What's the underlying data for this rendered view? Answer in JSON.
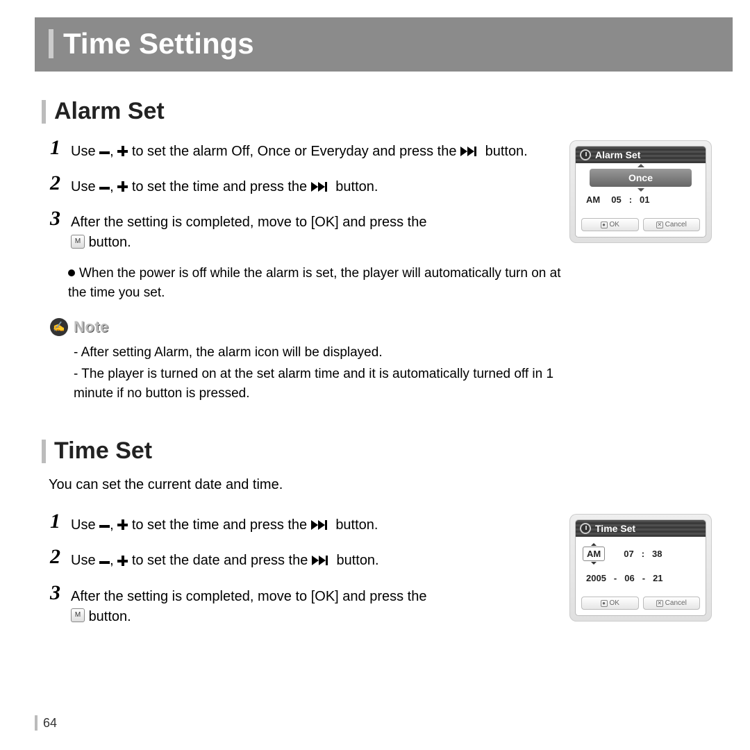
{
  "page": {
    "title": "Time Settings",
    "number": "64"
  },
  "alarm": {
    "heading": "Alarm Set",
    "step1_a": "Use ",
    "step1_b": " to set the alarm Off, Once or Everyday and press the ",
    "step1_c": " button.",
    "step2_a": "Use ",
    "step2_b": " to set the time and press the ",
    "step2_c": " button.",
    "step3_a": "After the setting is completed, move to [OK] and press the ",
    "step3_b": " button.",
    "bullet": "When the power is off while the alarm is set, the player will automatically turn on at the time you set.",
    "note_label": "Note",
    "note1": "After setting Alarm, the alarm icon will be displayed.",
    "note2": "The player is turned on at the set alarm time and it is automatically turned off in 1 minute if no button is pressed.",
    "device": {
      "title": "Alarm Set",
      "mode": "Once",
      "ampm": "AM",
      "hour": "05",
      "minute": "01",
      "ok": "OK",
      "cancel": "Cancel"
    }
  },
  "time": {
    "heading": "Time Set",
    "intro": "You can set the current date and time.",
    "step1_a": "Use ",
    "step1_b": "to set the time and press the",
    "step1_c": "button.",
    "step2_a": "Use ",
    "step2_b": "to set the date and press the",
    "step2_c": "button.",
    "step3_a": "After the setting is completed, move to [OK] and press the ",
    "step3_b": " button.",
    "device": {
      "title": "Time Set",
      "ampm": "AM",
      "hour": "07",
      "minute": "38",
      "year": "2005",
      "month": "06",
      "day": "21",
      "ok": "OK",
      "cancel": "Cancel"
    }
  }
}
